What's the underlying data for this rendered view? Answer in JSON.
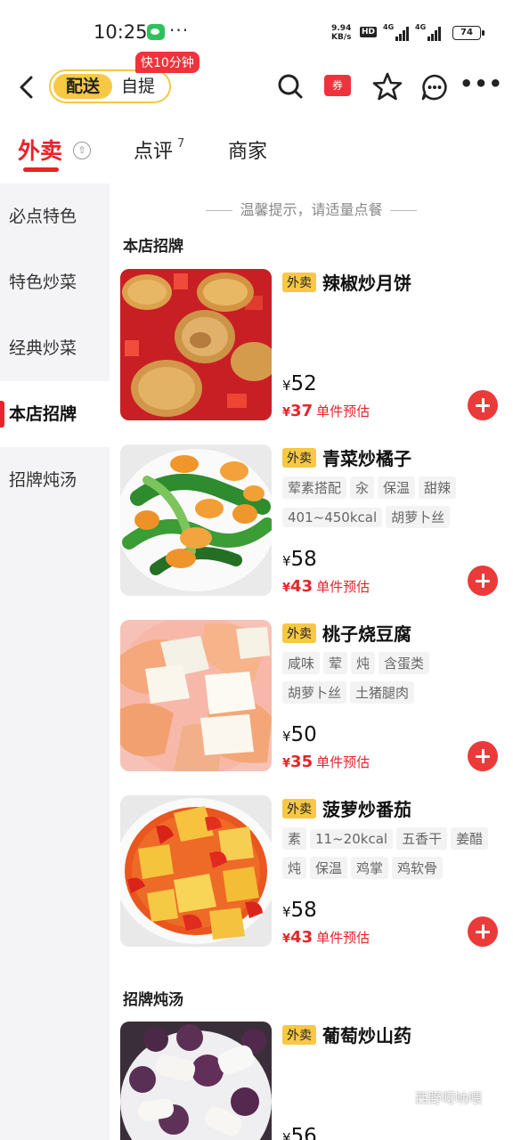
{
  "status_bar": {
    "time": "10:25",
    "dots": "···",
    "net_speed_value": "9.94",
    "net_speed_unit": "KB/s",
    "hd_label": "HD",
    "signal1_label": "4G",
    "signal2_label": "4G",
    "battery": "74"
  },
  "nav": {
    "delivery_label": "配送",
    "pickup_label": "自提",
    "fast_badge": "快10分钟",
    "coupon_label": "券"
  },
  "tabs": {
    "takeout": "外卖",
    "review": "点评",
    "review_count": "7",
    "shop": "商家"
  },
  "sidebar": {
    "items": [
      {
        "label": "必点特色"
      },
      {
        "label": "特色炒菜"
      },
      {
        "label": "经典炒菜"
      },
      {
        "label": "本店招牌"
      },
      {
        "label": "招牌炖汤"
      }
    ]
  },
  "main": {
    "tip": "温馨提示，请适量点餐",
    "section1": "本店招牌",
    "section2": "招牌炖汤",
    "currency": "¥",
    "est_note": "单件预估",
    "items": [
      {
        "tag": "外卖",
        "name": "辣椒炒月饼",
        "price": "52",
        "est": "37",
        "attrs": []
      },
      {
        "tag": "外卖",
        "name": "青菜炒橘子",
        "price": "58",
        "est": "43",
        "attrs": [
          "荤素搭配",
          "汆",
          "保温",
          "甜辣",
          "401~450kcal",
          "胡萝卜丝"
        ]
      },
      {
        "tag": "外卖",
        "name": "桃子烧豆腐",
        "price": "50",
        "est": "35",
        "attrs": [
          "咸味",
          "荤",
          "炖",
          "含蛋类",
          "胡萝卜丝",
          "土猪腿肉"
        ]
      },
      {
        "tag": "外卖",
        "name": "菠萝炒番茄",
        "price": "58",
        "est": "43",
        "attrs": [
          "素",
          "11~20kcal",
          "五香干",
          "姜醋",
          "炖",
          "保温",
          "鸡掌",
          "鸡软骨"
        ]
      },
      {
        "tag": "外卖",
        "name": "葡萄炒山药",
        "price": "56",
        "est": "",
        "attrs": []
      }
    ]
  },
  "watermark": "西野呀呐喂",
  "colors": {
    "accent_red": "#e8232b",
    "delivery_yellow": "#f7c844"
  }
}
